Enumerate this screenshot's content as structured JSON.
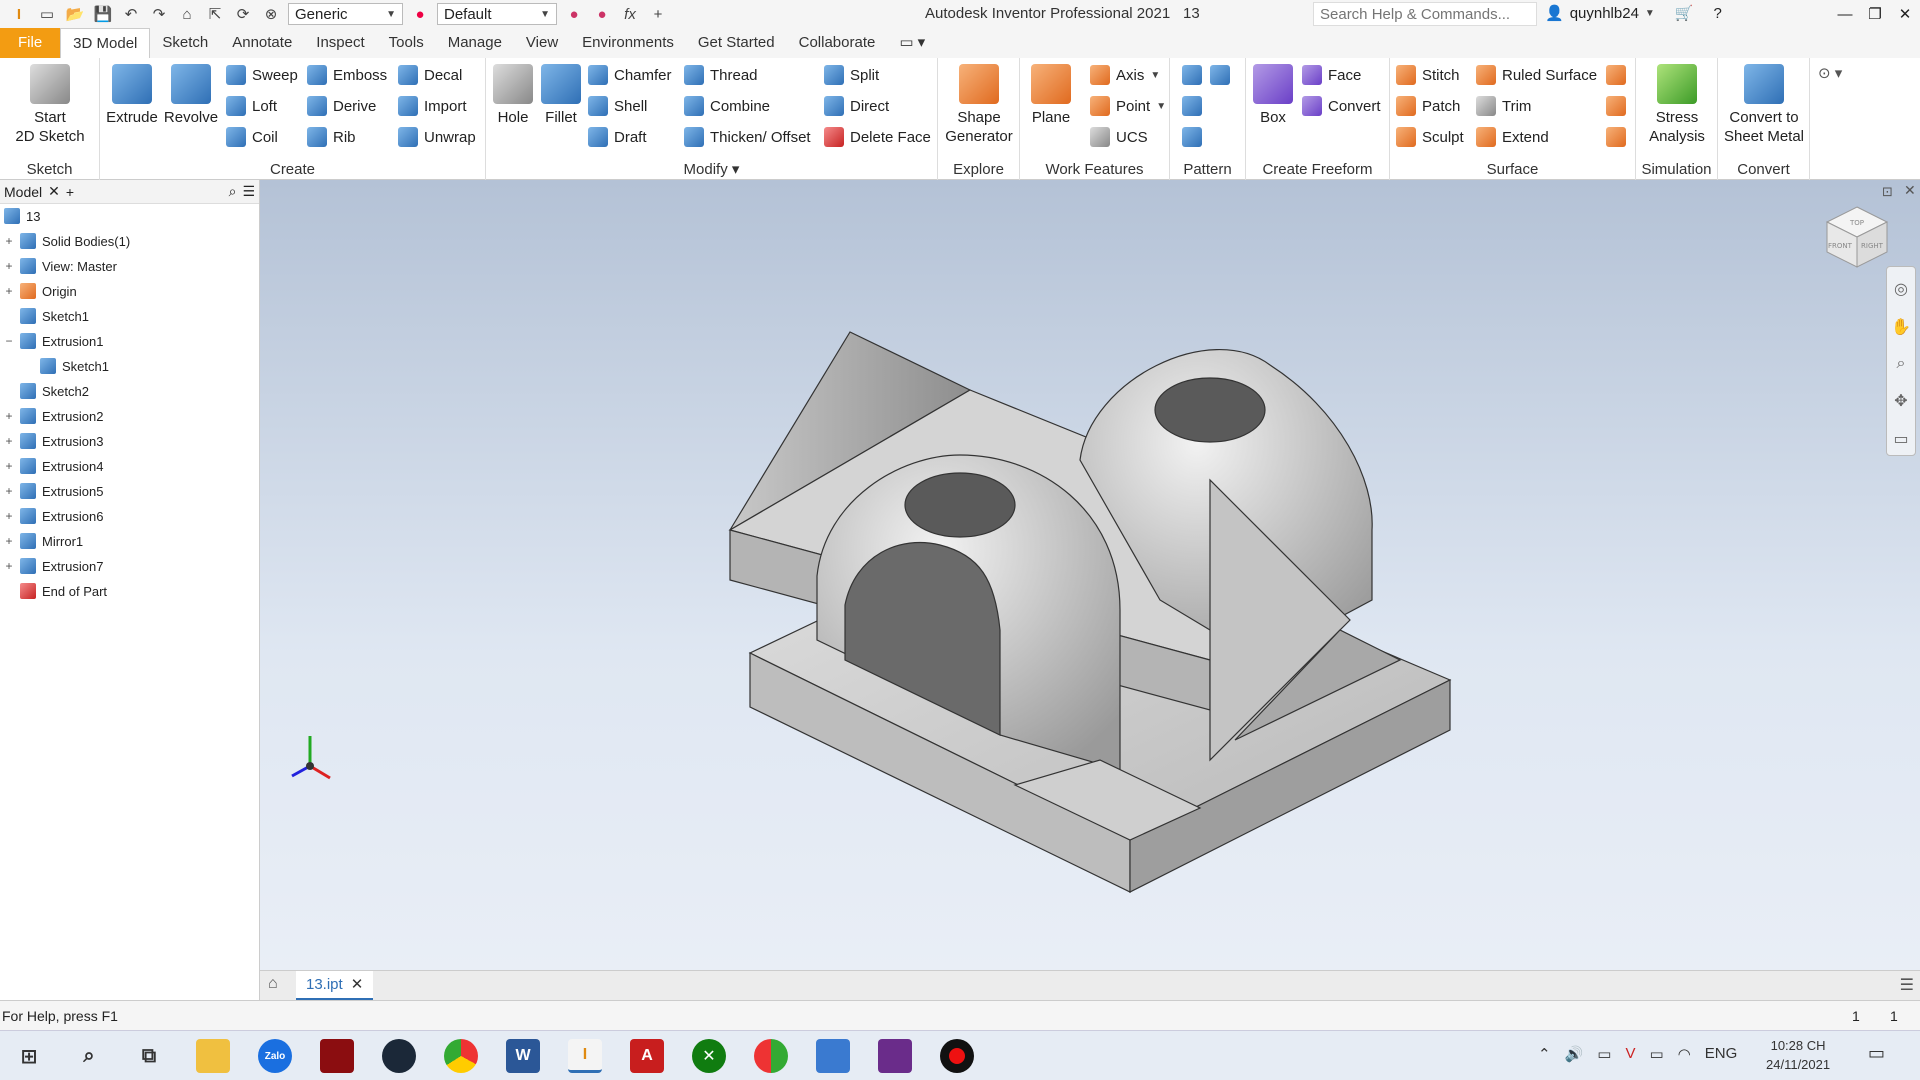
{
  "titlebar": {
    "appearance_value": "Generic",
    "material_value": "Default",
    "app_title": "Autodesk Inventor Professional 2021",
    "doc_name": "13",
    "search_placeholder": "Search Help & Commands...",
    "user": "quynhlb24"
  },
  "tabs": [
    "File",
    "3D Model",
    "Sketch",
    "Annotate",
    "Inspect",
    "Tools",
    "Manage",
    "View",
    "Environments",
    "Get Started",
    "Collaborate"
  ],
  "ribbon": {
    "sketch": {
      "title": "Sketch",
      "start": "Start\n2D Sketch"
    },
    "create": {
      "title": "Create",
      "extrude": "Extrude",
      "revolve": "Revolve",
      "sweep": "Sweep",
      "loft": "Loft",
      "coil": "Coil",
      "emboss": "Emboss",
      "derive": "Derive",
      "rib": "Rib",
      "decal": "Decal",
      "import": "Import",
      "unwrap": "Unwrap"
    },
    "modify": {
      "title": "Modify",
      "hole": "Hole",
      "fillet": "Fillet",
      "chamfer": "Chamfer",
      "shell": "Shell",
      "draft": "Draft",
      "thread": "Thread",
      "combine": "Combine",
      "thicken": "Thicken/ Offset",
      "split": "Split",
      "direct": "Direct",
      "delete_face": "Delete Face"
    },
    "explore": {
      "title": "Explore",
      "shape_gen": "Shape\nGenerator"
    },
    "work": {
      "title": "Work Features",
      "plane": "Plane",
      "axis": "Axis",
      "point": "Point",
      "ucs": "UCS"
    },
    "pattern": {
      "title": "Pattern"
    },
    "freeform": {
      "title": "Create Freeform",
      "box": "Box",
      "face": "Face",
      "convert": "Convert"
    },
    "surface": {
      "title": "Surface",
      "stitch": "Stitch",
      "patch": "Patch",
      "sculpt": "Sculpt",
      "ruled": "Ruled Surface",
      "trim": "Trim",
      "extend": "Extend"
    },
    "simulation": {
      "title": "Simulation",
      "stress": "Stress\nAnalysis"
    },
    "convert": {
      "title": "Convert",
      "sheet": "Convert to\nSheet Metal"
    }
  },
  "browser": {
    "tab": "Model",
    "root": "13",
    "items": [
      {
        "label": "Solid Bodies(1)",
        "exp": "+",
        "indent": 0
      },
      {
        "label": "View: Master",
        "exp": "+",
        "indent": 0
      },
      {
        "label": "Origin",
        "exp": "+",
        "indent": 0
      },
      {
        "label": "Sketch1",
        "exp": "",
        "indent": 0
      },
      {
        "label": "Extrusion1",
        "exp": "−",
        "indent": 0
      },
      {
        "label": "Sketch1",
        "exp": "",
        "indent": 1
      },
      {
        "label": "Sketch2",
        "exp": "",
        "indent": 0
      },
      {
        "label": "Extrusion2",
        "exp": "+",
        "indent": 0
      },
      {
        "label": "Extrusion3",
        "exp": "+",
        "indent": 0
      },
      {
        "label": "Extrusion4",
        "exp": "+",
        "indent": 0
      },
      {
        "label": "Extrusion5",
        "exp": "+",
        "indent": 0
      },
      {
        "label": "Extrusion6",
        "exp": "+",
        "indent": 0
      },
      {
        "label": "Mirror1",
        "exp": "+",
        "indent": 0
      },
      {
        "label": "Extrusion7",
        "exp": "+",
        "indent": 0
      },
      {
        "label": "End of Part",
        "exp": "",
        "indent": 0
      }
    ]
  },
  "viewcube": {
    "top": "TOP",
    "front": "FRONT",
    "right": "RIGHT"
  },
  "doc_tab": "13.ipt",
  "status": {
    "help": "For Help, press F1",
    "num1": "1",
    "num2": "1"
  },
  "taskbar": {
    "lang": "ENG",
    "time": "10:28 CH",
    "date": "24/11/2021"
  }
}
